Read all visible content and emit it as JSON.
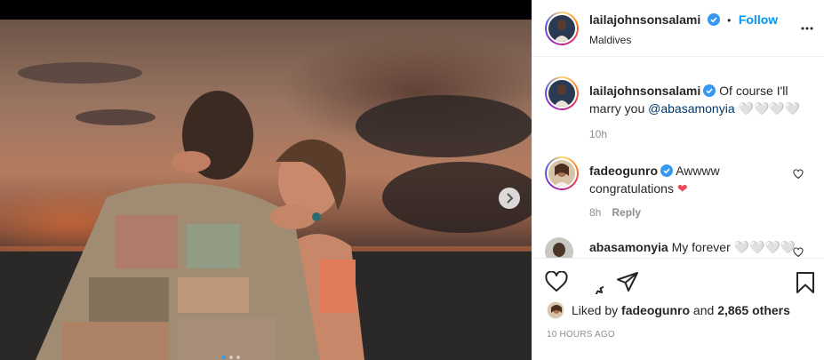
{
  "post": {
    "username": "lailajohnsonsalami",
    "separator": "•",
    "follow_label": "Follow",
    "location": "Maldives"
  },
  "comments": [
    {
      "username": "lailajohnsonsalami",
      "text_before": "Of course I'll marry you ",
      "mention": "@abasamonyia",
      "text_after": " 🤍🤍🤍🤍",
      "time": "10h"
    },
    {
      "username": "fadeogunro",
      "text": "Awwww congratulations ",
      "emoji": "❤",
      "time": "8h",
      "reply_label": "Reply"
    },
    {
      "username": "abasamonyia",
      "text": "My forever 🤍🤍🤍🤍"
    }
  ],
  "likes": {
    "prefix": "Liked by ",
    "user": "fadeogunro",
    "middle": " and ",
    "count": "2,865 others"
  },
  "posted_time": "10 HOURS AGO",
  "icons": {
    "like": "heart-icon",
    "comment": "comment-icon",
    "share": "share-icon",
    "save": "bookmark-icon",
    "more": "more-options-icon",
    "next": "chevron-right-icon",
    "verified": "verified-badge-icon"
  },
  "colors": {
    "accent": "#0095f6",
    "verified": "#3897f0",
    "heart": "#ed4956",
    "muted": "#8e8e8e"
  }
}
